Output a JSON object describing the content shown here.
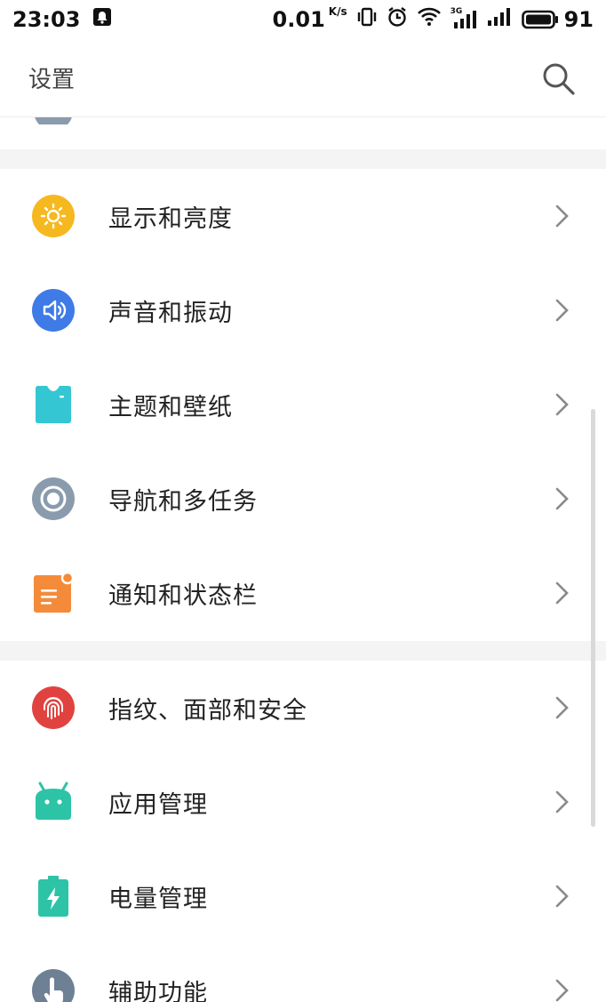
{
  "status_bar": {
    "time": "23:03",
    "net_speed": "0.01",
    "net_speed_unit": "K/s",
    "network_type": "3G",
    "battery": "91"
  },
  "header": {
    "title": "设置"
  },
  "sections": [
    {
      "items": [
        {
          "label": "显示和亮度",
          "icon": "sun-icon",
          "color": "#F6B81F"
        },
        {
          "label": "声音和振动",
          "icon": "speaker-icon",
          "color": "#3E7BE6"
        },
        {
          "label": "主题和壁纸",
          "icon": "shirt-icon",
          "color": "#34C7D3"
        },
        {
          "label": "导航和多任务",
          "icon": "navigation-ring-icon",
          "color": "#8A9BAD"
        },
        {
          "label": "通知和状态栏",
          "icon": "notification-icon",
          "color": "#F48B3A"
        }
      ]
    },
    {
      "items": [
        {
          "label": "指纹、面部和安全",
          "icon": "fingerprint-icon",
          "color": "#E0433F"
        },
        {
          "label": "应用管理",
          "icon": "android-icon",
          "color": "#2DC3A7"
        },
        {
          "label": "电量管理",
          "icon": "battery-bolt-icon",
          "color": "#2DC3A7"
        },
        {
          "label": "辅助功能",
          "icon": "hand-icon",
          "color": "#6E8094"
        }
      ]
    }
  ]
}
